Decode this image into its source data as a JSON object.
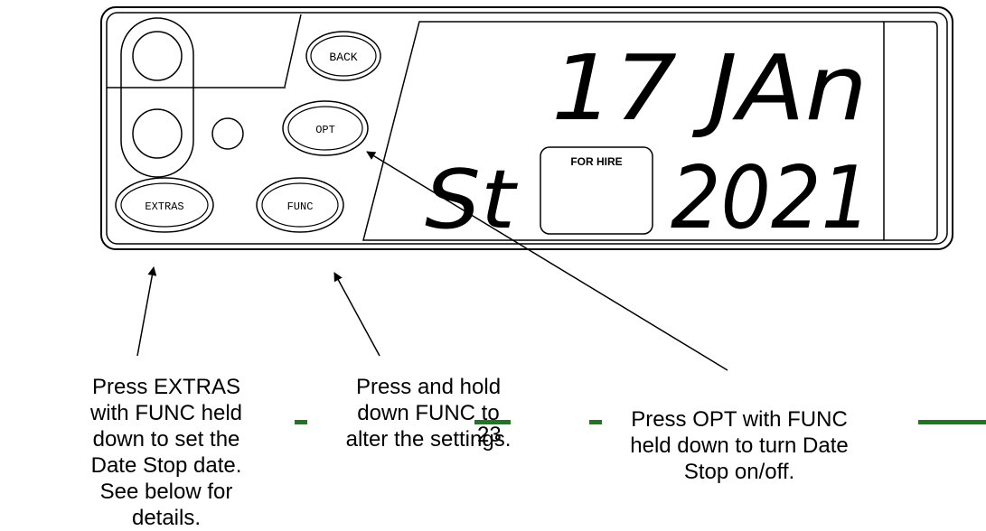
{
  "meter": {
    "buttons": {
      "back": "BACK",
      "opt": "OPT",
      "extras": "EXTRAS",
      "func": "FUNC"
    },
    "display": {
      "top_line": "17 JAn",
      "bottom_left": "St",
      "bottom_right": "2021"
    },
    "for_hire_label": "FOR HIRE"
  },
  "captions": {
    "extras": "Press EXTRAS with FUNC held down to set the Date Stop date. See below for details.",
    "func": "Press and hold down FUNC to alter the settings.",
    "opt": "Press OPT with FUNC held down to turn Date Stop on/off."
  },
  "page_number": "23",
  "colors": {
    "line": "#000000",
    "dash": "#1b7a1b"
  }
}
